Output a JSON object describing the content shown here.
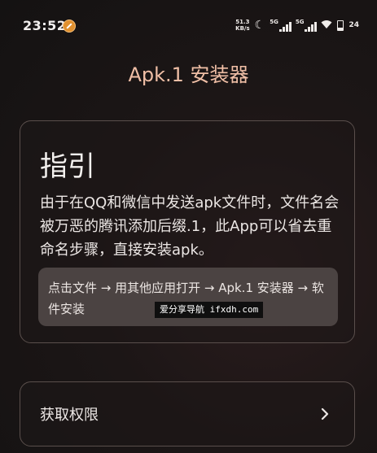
{
  "status_bar": {
    "time": "23:52",
    "net_speed_value": "51.3",
    "net_speed_unit": "KB/s",
    "sim1_label": "5G",
    "sim2_label": "5G",
    "battery": "24",
    "icons": [
      "app-notification-icon",
      "moon-icon",
      "signal-icon",
      "signal-icon",
      "wifi-icon",
      "battery-icon"
    ]
  },
  "app": {
    "title": "Apk.1 安装器"
  },
  "guide": {
    "heading": "指引",
    "body": "由于在QQ和微信中发送apk文件时，文件名会被万恶的腾讯添加后缀.1，此App可以省去重命名步骤，直接安装apk。",
    "steps": "点击文件 → 用其他应用打开 → Apk.1 安装器 → 软件安装"
  },
  "watermark": "爱分享导航 ifxdh.com",
  "permission": {
    "label": "获取权限"
  },
  "colors": {
    "title_accent": "#f0bfa6",
    "steps_bg": "#4b4342"
  }
}
